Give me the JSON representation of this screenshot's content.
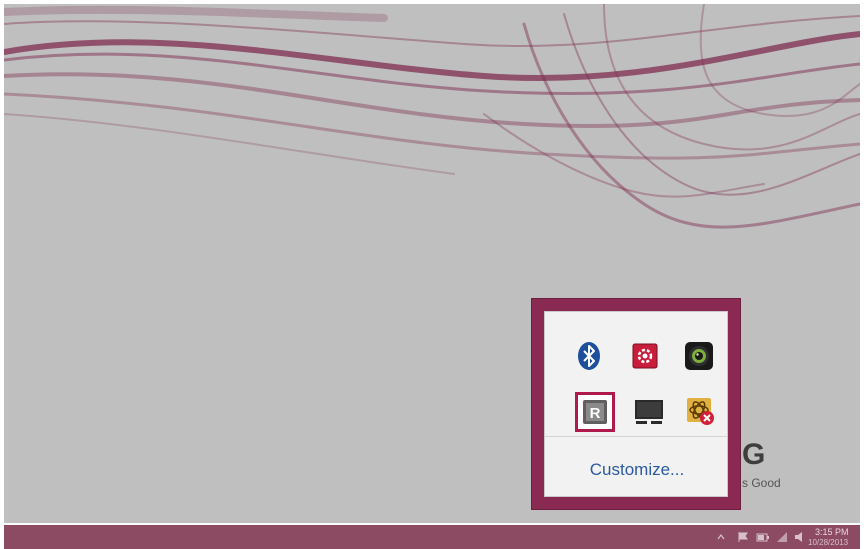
{
  "desktop": {
    "brand_logo": "G",
    "brand_slogan": "s Good"
  },
  "tray_flyout": {
    "icons": [
      {
        "name": "bluetooth-icon"
      },
      {
        "name": "settings-gear-icon"
      },
      {
        "name": "camera-app-icon"
      },
      {
        "name": "reader-r-icon",
        "selected": true
      },
      {
        "name": "display-monitor-icon"
      },
      {
        "name": "network-error-icon"
      }
    ],
    "customize_label": "Customize..."
  },
  "taskbar": {
    "clock_time": "3:15 PM",
    "clock_date": "10/28/2013"
  },
  "colors": {
    "accent": "#b01a4a",
    "taskbar": "#8c4a63",
    "link": "#2b5aa0"
  }
}
